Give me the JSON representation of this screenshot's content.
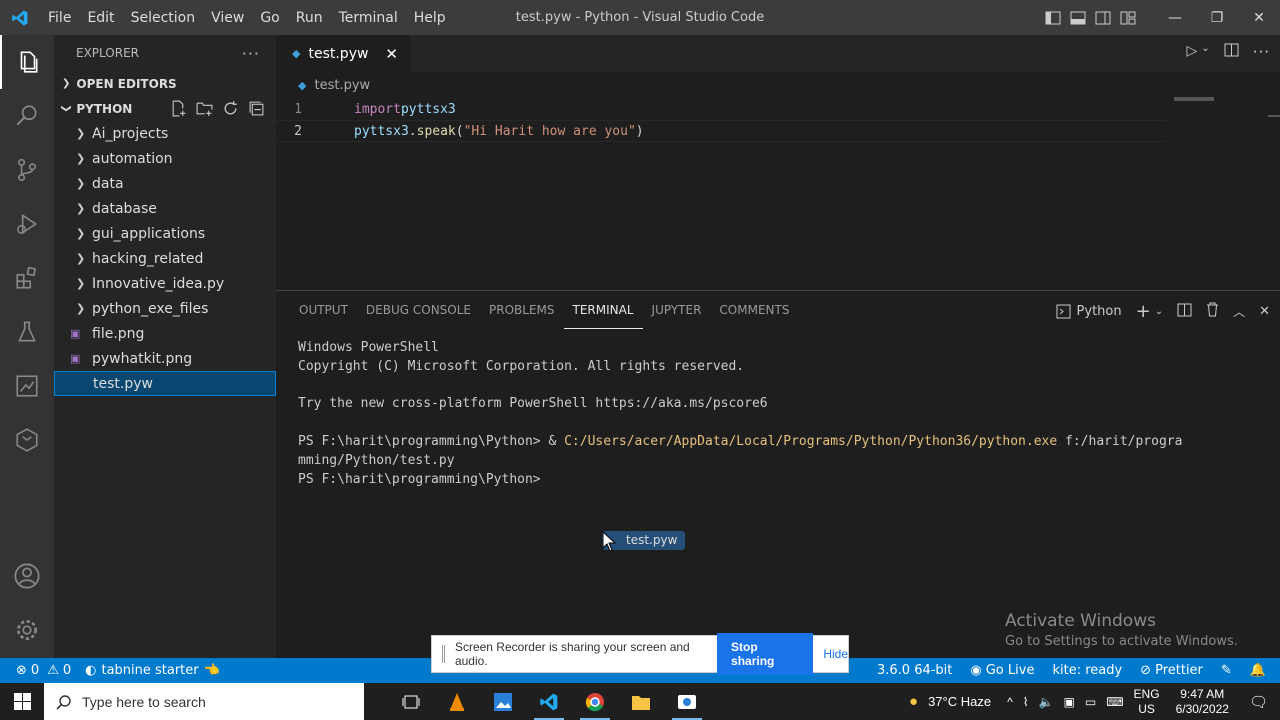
{
  "window": {
    "title": "test.pyw - Python - Visual Studio Code"
  },
  "menu": [
    "File",
    "Edit",
    "Selection",
    "View",
    "Go",
    "Run",
    "Terminal",
    "Help"
  ],
  "sidebar": {
    "header": "EXPLORER",
    "open_editors": "OPEN EDITORS",
    "folder": "PYTHON",
    "items": [
      {
        "label": "Ai_projects",
        "type": "folder"
      },
      {
        "label": "automation",
        "type": "folder"
      },
      {
        "label": "data",
        "type": "folder"
      },
      {
        "label": "database",
        "type": "folder"
      },
      {
        "label": "gui_applications",
        "type": "folder"
      },
      {
        "label": "hacking_related",
        "type": "folder"
      },
      {
        "label": "Innovative_idea.py",
        "type": "folder"
      },
      {
        "label": "python_exe_files",
        "type": "folder"
      },
      {
        "label": "file.png",
        "type": "file"
      },
      {
        "label": "pywhatkit.png",
        "type": "file"
      },
      {
        "label": "test.pyw",
        "type": "file",
        "selected": true
      }
    ]
  },
  "editor": {
    "tab": "test.pyw",
    "breadcrumb": "test.pyw",
    "lines": [
      {
        "num": "1",
        "t1": "import",
        "t2": " pyttsx3",
        "t3": "",
        "t4": "",
        "t5": "",
        "t6": ""
      },
      {
        "num": "2",
        "t1": "",
        "t2": "pyttsx3",
        "t3": ".",
        "t4": "speak",
        "t5": "(",
        "t6": "\"Hi Harit how are you\"",
        "t7": ")"
      }
    ]
  },
  "panel": {
    "tabs": [
      "OUTPUT",
      "DEBUG CONSOLE",
      "PROBLEMS",
      "TERMINAL",
      "JUPYTER",
      "COMMENTS"
    ],
    "active_tab": "TERMINAL",
    "shell": "Python",
    "terminal": {
      "l1": "Windows PowerShell",
      "l2": "Copyright (C) Microsoft Corporation. All rights reserved.",
      "l3": "Try the new cross-platform PowerShell https://aka.ms/pscore6",
      "l4a": "PS F:\\harit\\programming\\Python> & ",
      "l4b": "C:/Users/acer/AppData/Local/Programs/Python/Python36/python.exe",
      "l4c": " f:/harit/progra",
      "l5": "mming/Python/test.py",
      "l6": "PS F:\\harit\\programming\\Python> "
    },
    "drag_ghost": "test.pyw"
  },
  "activate": {
    "line1": "Activate Windows",
    "line2": "Go to Settings to activate Windows."
  },
  "statusbar": {
    "errors": "0",
    "warnings": "0",
    "tabnine": "tabnine starter",
    "python_version": "3.6.0 64-bit",
    "golive": "Go Live",
    "kite": "kite: ready",
    "prettier": "Prettier"
  },
  "sharebar": {
    "message": "Screen Recorder is sharing your screen and audio.",
    "stop": "Stop sharing",
    "hide": "Hide"
  },
  "taskbar": {
    "search_placeholder": "Type here to search",
    "weather": "37°C  Haze",
    "lang1": "ENG",
    "lang2": "US",
    "time": "9:47 AM",
    "date": "6/30/2022"
  },
  "colors": {
    "accent": "#007acc",
    "selection": "#094771"
  }
}
